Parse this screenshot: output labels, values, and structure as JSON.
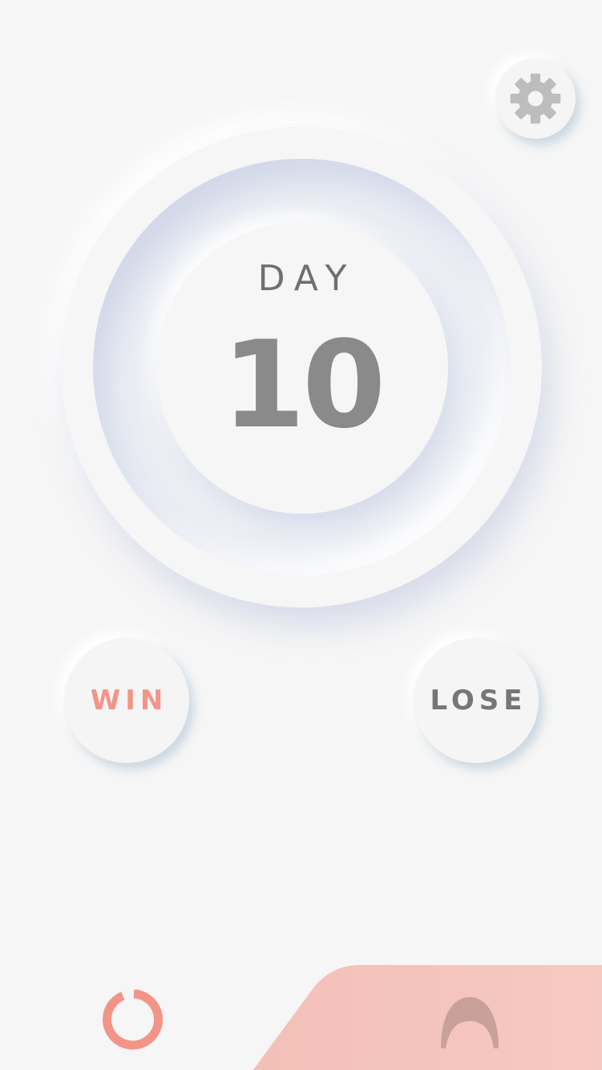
{
  "settings": {
    "icon": "gear-icon"
  },
  "dial": {
    "label": "DAY",
    "value": "10"
  },
  "actions": {
    "win_label": "WIN",
    "lose_label": "LOSE"
  },
  "bottom_bar": {
    "left_icon": "reset-ring-icon",
    "right_icon": "arch-icon"
  },
  "colors": {
    "background": "#f6f6f6",
    "accent": "#f39488",
    "panel": "#f5c4bc",
    "text_gray": "#8a8a8a",
    "icon_gray": "#bdbdbd",
    "arch": "#c9a09a"
  }
}
